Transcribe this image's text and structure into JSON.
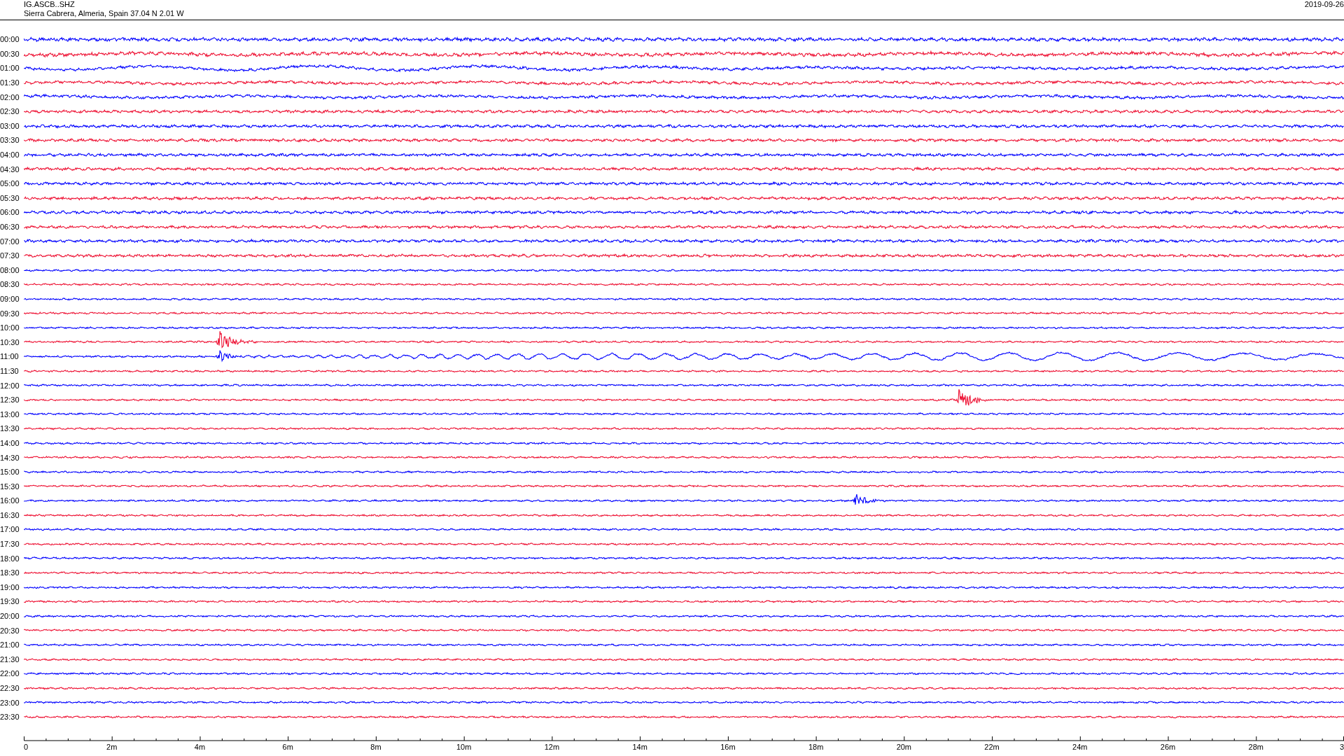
{
  "header": {
    "station": "IG.ASCB..SHZ",
    "location": "Sierra Cabrera, Almeria, Spain  37.04 N 2.01 W",
    "date": "2019-09-26"
  },
  "traces": [
    {
      "time": "00:00",
      "color": "#0000ff"
    },
    {
      "time": "00:30",
      "color": "#ee1133"
    },
    {
      "time": "01:00",
      "color": "#0000ff"
    },
    {
      "time": "01:30",
      "color": "#ee1133"
    },
    {
      "time": "02:00",
      "color": "#0000ff"
    },
    {
      "time": "02:30",
      "color": "#ee1133"
    },
    {
      "time": "03:00",
      "color": "#0000ff"
    },
    {
      "time": "03:30",
      "color": "#ee1133"
    },
    {
      "time": "04:00",
      "color": "#0000ff"
    },
    {
      "time": "04:30",
      "color": "#ee1133"
    },
    {
      "time": "05:00",
      "color": "#0000ff"
    },
    {
      "time": "05:30",
      "color": "#ee1133"
    },
    {
      "time": "06:00",
      "color": "#0000ff"
    },
    {
      "time": "06:30",
      "color": "#ee1133"
    },
    {
      "time": "07:00",
      "color": "#0000ff"
    },
    {
      "time": "07:30",
      "color": "#ee1133"
    },
    {
      "time": "08:00",
      "color": "#0000ff"
    },
    {
      "time": "08:30",
      "color": "#ee1133"
    },
    {
      "time": "09:00",
      "color": "#0000ff"
    },
    {
      "time": "09:30",
      "color": "#ee1133"
    },
    {
      "time": "10:00",
      "color": "#0000ff"
    },
    {
      "time": "10:30",
      "color": "#ee1133"
    },
    {
      "time": "11:00",
      "color": "#0000ff"
    },
    {
      "time": "11:30",
      "color": "#ee1133"
    },
    {
      "time": "12:00",
      "color": "#0000ff"
    },
    {
      "time": "12:30",
      "color": "#ee1133"
    },
    {
      "time": "13:00",
      "color": "#0000ff"
    },
    {
      "time": "13:30",
      "color": "#ee1133"
    },
    {
      "time": "14:00",
      "color": "#0000ff"
    },
    {
      "time": "14:30",
      "color": "#ee1133"
    },
    {
      "time": "15:00",
      "color": "#0000ff"
    },
    {
      "time": "15:30",
      "color": "#ee1133"
    },
    {
      "time": "16:00",
      "color": "#0000ff"
    },
    {
      "time": "16:30",
      "color": "#ee1133"
    },
    {
      "time": "17:00",
      "color": "#0000ff"
    },
    {
      "time": "17:30",
      "color": "#ee1133"
    },
    {
      "time": "18:00",
      "color": "#0000ff"
    },
    {
      "time": "18:30",
      "color": "#ee1133"
    },
    {
      "time": "19:00",
      "color": "#0000ff"
    },
    {
      "time": "19:30",
      "color": "#ee1133"
    },
    {
      "time": "20:00",
      "color": "#0000ff"
    },
    {
      "time": "20:30",
      "color": "#ee1133"
    },
    {
      "time": "21:00",
      "color": "#0000ff"
    },
    {
      "time": "21:30",
      "color": "#ee1133"
    },
    {
      "time": "22:00",
      "color": "#0000ff"
    },
    {
      "time": "22:30",
      "color": "#ee1133"
    },
    {
      "time": "23:00",
      "color": "#0000ff"
    },
    {
      "time": "23:30",
      "color": "#ee1133"
    }
  ],
  "time_axis": {
    "labels": [
      "0",
      "2m",
      "4m",
      "6m",
      "8m",
      "10m",
      "12m",
      "14m",
      "16m",
      "18m",
      "20m",
      "22m",
      "24m",
      "26m",
      "28m",
      "3"
    ]
  }
}
